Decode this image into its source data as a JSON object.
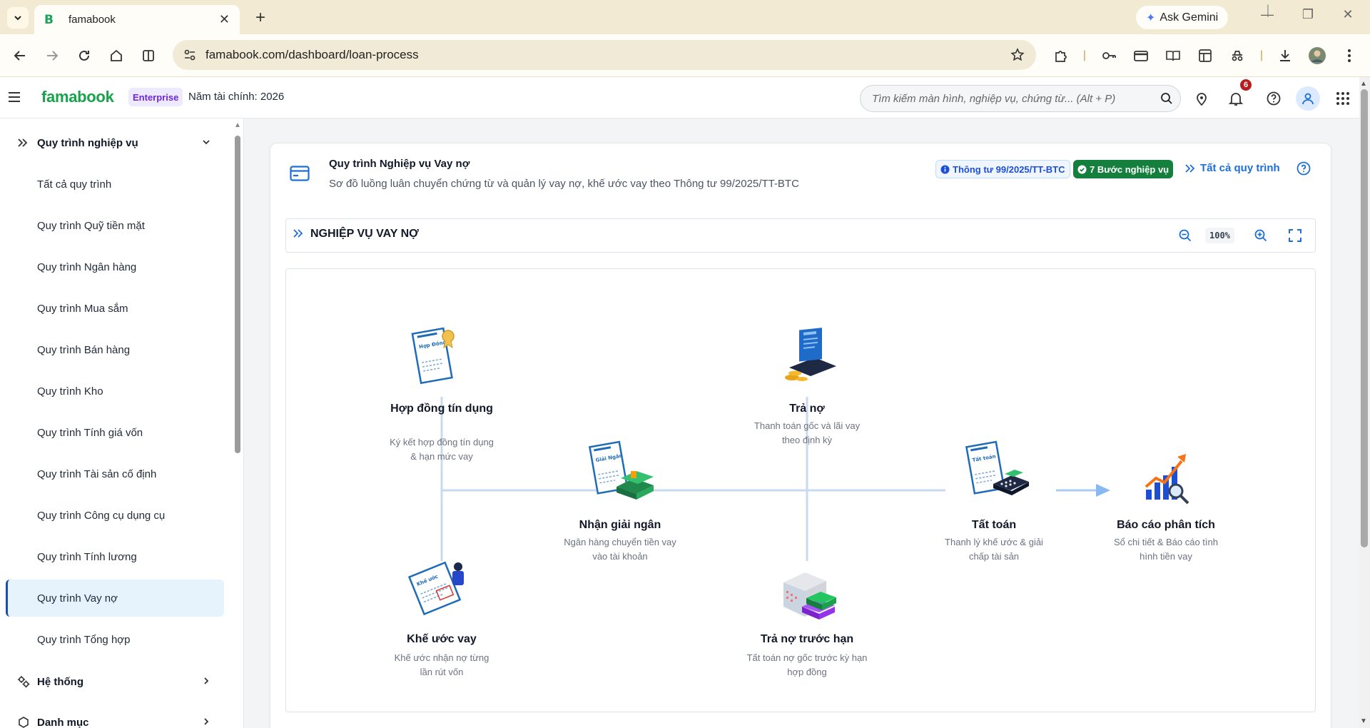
{
  "browser": {
    "tab_title": "famabook",
    "tab_favicon": "B",
    "gemini_label": "Ask Gemini",
    "url": "famabook.com/dashboard/loan-process"
  },
  "header": {
    "brand": "famabook",
    "plan_badge": "Enterprise",
    "fiscal_year": "Năm tài chính: 2026",
    "search_placeholder": "Tìm kiếm màn hình, nghiệp vụ, chứng từ... (Alt + P)",
    "notification_count": "6"
  },
  "sidebar": {
    "group_process": "Quy trình nghiệp vụ",
    "items": [
      {
        "label": "Tất cả quy trình"
      },
      {
        "label": "Quy trình Quỹ tiền mặt"
      },
      {
        "label": "Quy trình Ngân hàng"
      },
      {
        "label": "Quy trình Mua sắm"
      },
      {
        "label": "Quy trình Bán hàng"
      },
      {
        "label": "Quy trình Kho"
      },
      {
        "label": "Quy trình Tính giá vốn"
      },
      {
        "label": "Quy trình Tài sản cố định"
      },
      {
        "label": "Quy trình Công cụ dụng cụ"
      },
      {
        "label": "Quy trình Tính lương"
      },
      {
        "label": "Quy trình Vay nợ"
      },
      {
        "label": "Quy trình Tổng hợp"
      }
    ],
    "active_item": "Quy trình Vay nợ",
    "group_system": "Hệ thống",
    "group_catalog": "Danh mục"
  },
  "card": {
    "title": "Quy trình Nghiệp vụ Vay nợ",
    "subtitle": "Sơ đồ luồng luân chuyển chứng từ và quản lý vay nợ, khế ước vay theo Thông tư 99/2025/TT-BTC",
    "legal_badge": "Thông tư 99/2025/TT-BTC",
    "steps_badge": "7 Bước nghiệp vụ",
    "all_link": "Tất cả quy trình"
  },
  "diagram": {
    "title": "NGHIỆP VỤ VAY NỢ",
    "zoom": "100%",
    "nodes": [
      {
        "id": "contract",
        "title": "Hợp đồng tín dụng",
        "desc": "Ký kết hợp đồng tín dụng & hạn mức vay",
        "icon": "contract-document-icon",
        "doc_label": "Hợp Đồng"
      },
      {
        "id": "covenant",
        "title": "Khế ước vay",
        "desc": "Khế ước nhận nợ từng lần rút vốn",
        "icon": "loan-covenant-icon",
        "doc_label": "Khế ước"
      },
      {
        "id": "disburse",
        "title": "Nhận giải ngân",
        "desc": "Ngân hàng chuyển tiền vay vào tài khoản",
        "icon": "disbursement-icon",
        "doc_label": "Giải Ngân"
      },
      {
        "id": "repay",
        "title": "Trả nợ",
        "desc": "Thanh toán gốc và lãi vay theo định kỳ",
        "icon": "repayment-laptop-icon"
      },
      {
        "id": "prepay",
        "title": "Trả nợ trước hạn",
        "desc": "Tất toán nợ gốc trước kỳ hạn hợp đồng",
        "icon": "early-repayment-icon"
      },
      {
        "id": "settle",
        "title": "Tất toán",
        "desc": "Thanh lý khế ước & giải chấp tài sản",
        "icon": "settlement-icon",
        "doc_label": "Tất toán"
      },
      {
        "id": "report",
        "title": "Báo cáo phân tích",
        "desc": "Sổ chi tiết & Báo cáo tình hình tiền vay",
        "icon": "analytics-chart-icon"
      }
    ]
  },
  "colors": {
    "brand_green": "#16a34a",
    "accent_blue": "#1d6fd6",
    "active_bg": "#e6f3fd",
    "steps_badge_bg": "#15803d",
    "connector": "#c9d9ef"
  }
}
